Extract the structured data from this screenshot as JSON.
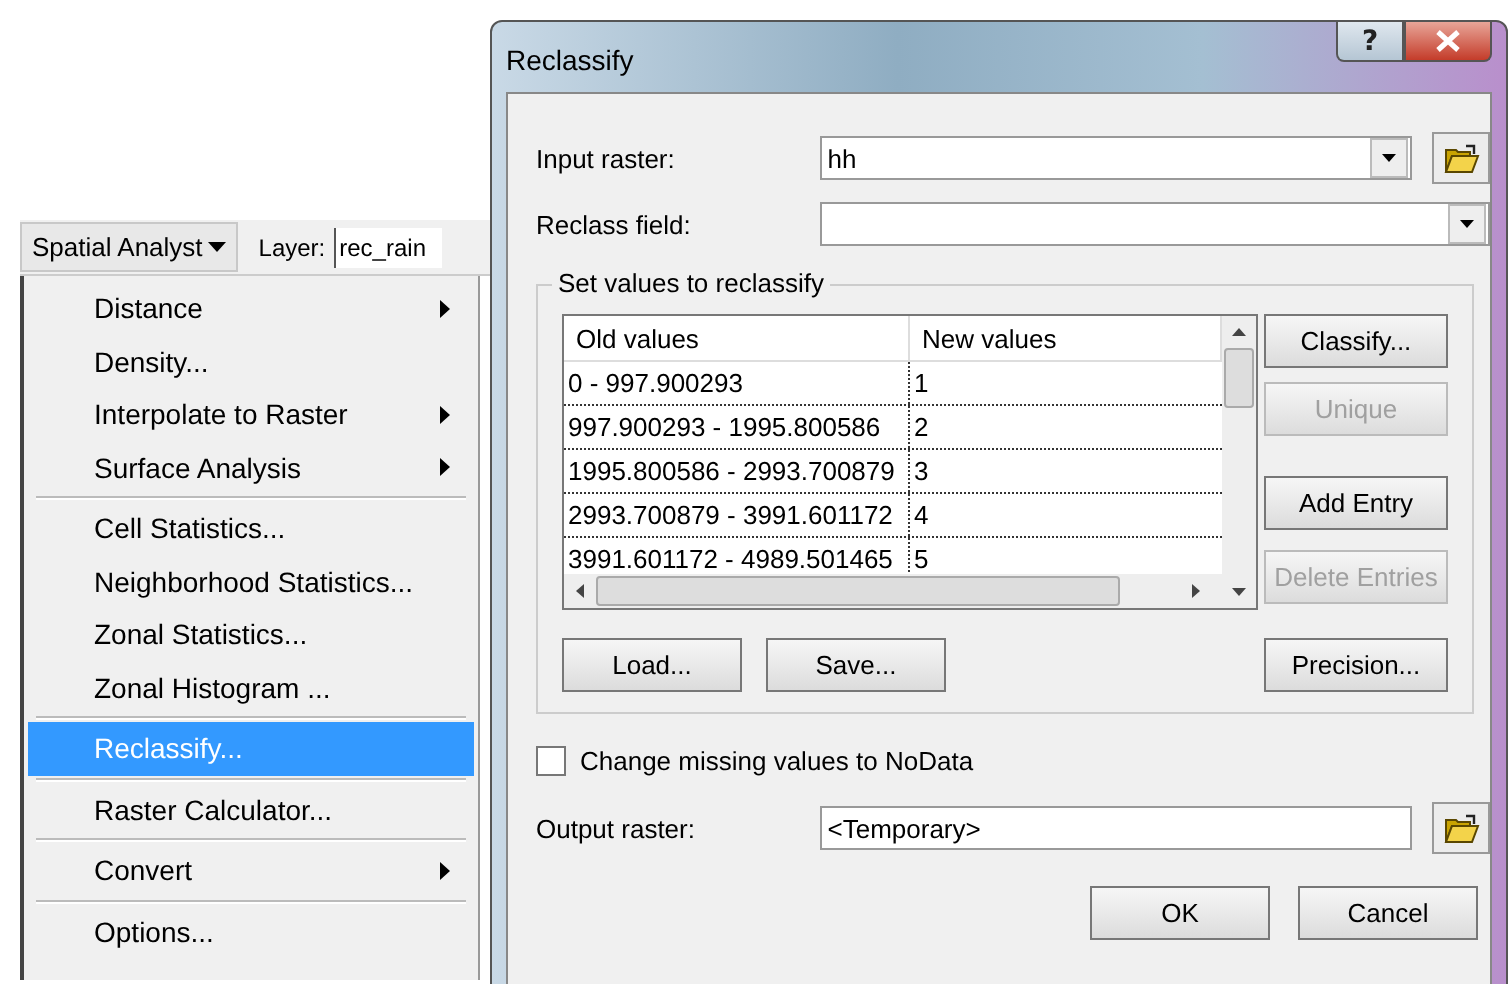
{
  "toolbar": {
    "menu_button": "Spatial Analyst",
    "layer_label": "Layer:",
    "layer_value": "rec_rain"
  },
  "menu": {
    "groups": [
      {
        "items": [
          {
            "label": "Distance",
            "submenu": true,
            "selected": false
          },
          {
            "label": "Density...",
            "submenu": false,
            "selected": false
          },
          {
            "label": "Interpolate to Raster",
            "submenu": true,
            "selected": false
          },
          {
            "label": "Surface Analysis",
            "submenu": true,
            "selected": false
          }
        ]
      },
      {
        "items": [
          {
            "label": "Cell Statistics...",
            "submenu": false,
            "selected": false
          },
          {
            "label": "Neighborhood Statistics...",
            "submenu": false,
            "selected": false
          },
          {
            "label": "Zonal Statistics...",
            "submenu": false,
            "selected": false
          },
          {
            "label": "Zonal Histogram ...",
            "submenu": false,
            "selected": false
          }
        ]
      },
      {
        "items": [
          {
            "label": "Reclassify...",
            "submenu": false,
            "selected": true
          }
        ]
      },
      {
        "items": [
          {
            "label": "Raster Calculator...",
            "submenu": false,
            "selected": false
          }
        ]
      },
      {
        "items": [
          {
            "label": "Convert",
            "submenu": true,
            "selected": false
          }
        ]
      },
      {
        "items": [
          {
            "label": "Options...",
            "submenu": false,
            "selected": false
          }
        ]
      }
    ]
  },
  "dialog": {
    "title": "Reclassify",
    "help_button": "?",
    "input_raster": {
      "label": "Input raster:",
      "value": "hh"
    },
    "reclass_field": {
      "label": "Reclass field:"
    },
    "group_title": "Set values to reclassify",
    "table": {
      "columns": [
        "Old values",
        "New values"
      ],
      "rows": [
        [
          "0 - 997.900293",
          "1"
        ],
        [
          "997.900293 - 1995.800586",
          "2"
        ],
        [
          "1995.800586 - 2993.700879",
          "3"
        ],
        [
          "2993.700879 - 3991.601172",
          "4"
        ],
        [
          "3991.601172 - 4989.501465",
          "5"
        ]
      ]
    },
    "side_buttons": [
      {
        "label": "Classify...",
        "disabled": false
      },
      {
        "label": "Unique",
        "disabled": true
      },
      {
        "label": "Add Entry",
        "disabled": false
      },
      {
        "label": "Delete Entries",
        "disabled": true
      }
    ],
    "load_button": "Load...",
    "save_button": "Save...",
    "precision_button": "Precision...",
    "missing_checkbox": {
      "label": "Change missing values to NoData",
      "checked": false
    },
    "output_raster": {
      "label": "Output raster:",
      "value": "<Temporary>"
    },
    "ok_button": "OK",
    "cancel_button": "Cancel"
  }
}
